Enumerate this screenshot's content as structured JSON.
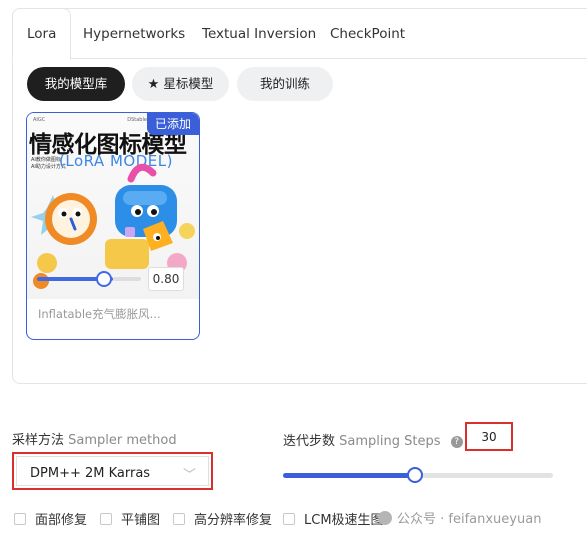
{
  "tabs": [
    {
      "label": "Lora",
      "active": true
    },
    {
      "label": "Hypernetworks"
    },
    {
      "label": "Textual Inversion"
    },
    {
      "label": "CheckPoint"
    }
  ],
  "filters": {
    "my_models": "我的模型库",
    "starred": "星标模型",
    "my_training": "我的训练"
  },
  "model_card": {
    "badge": "已添加",
    "poster_header_left": "AIGC",
    "poster_header_right": "DStableDiffusion",
    "poster_title": "情感化图标模型",
    "poster_subtitle": "(LoRA MODEL)",
    "poster_small_line1": "AI教你做图标",
    "poster_small_line2": "AI助力设计方式",
    "weight": "0.80",
    "weight_fraction": 0.8,
    "name": "Inflatable充气膨胀风..."
  },
  "sampler": {
    "label_cn": "采样方法",
    "label_en": "Sampler method",
    "value": "DPM++ 2M Karras"
  },
  "steps": {
    "label_cn": "迭代步数",
    "label_en": "Sampling Steps",
    "help": "?",
    "value": "30",
    "fraction": 0.49
  },
  "options": [
    {
      "label": "面部修复",
      "checked": false
    },
    {
      "label": "平铺图",
      "checked": false
    },
    {
      "label": "高分辨率修复",
      "checked": false
    },
    {
      "label": "LCM极速生图",
      "checked": false
    }
  ],
  "watermark": "公众号 · feifanxueyuan",
  "colors": {
    "accent": "#3b5fd9",
    "highlight": "#d9302c",
    "dark_pill": "#1f1f1f"
  }
}
